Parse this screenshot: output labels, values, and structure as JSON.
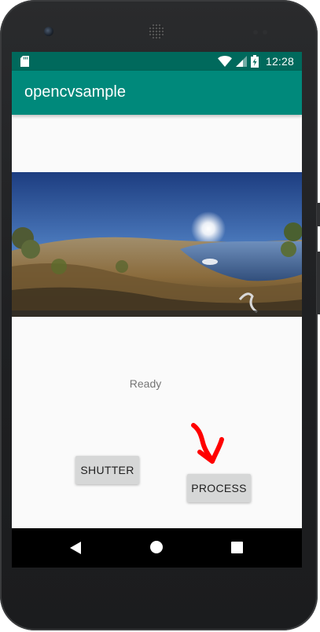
{
  "status_bar": {
    "time": "12:28",
    "icons": [
      "sd-card-icon",
      "wifi-icon",
      "cell-signal-icon",
      "battery-charging-icon"
    ],
    "background": "#00695c"
  },
  "app_bar": {
    "title": "opencvsample",
    "background": "#00897b"
  },
  "content": {
    "image": "panorama-photo",
    "status_text": "Ready"
  },
  "buttons": {
    "shutter_label": "SHUTTER",
    "process_label": "PROCESS"
  },
  "annotation": {
    "icon": "red-arrow-icon",
    "color": "#ff0000"
  },
  "nav_bar": {
    "icons": [
      "back-icon",
      "home-icon",
      "recents-icon"
    ]
  }
}
